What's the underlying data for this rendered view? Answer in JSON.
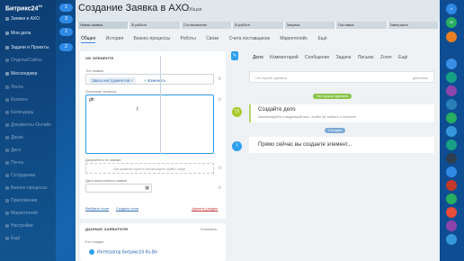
{
  "sidebar": {
    "brand": "Битрикс24",
    "items": [
      {
        "label": "Заявки в АХО"
      },
      {
        "label": "Мои дела"
      },
      {
        "label": "Задачи и Проекты"
      },
      {
        "label": "Отделы/Сайты"
      },
      {
        "label": "Мессенджер"
      },
      {
        "label": "Лента"
      },
      {
        "label": "Коллеги"
      },
      {
        "label": "Календарь"
      },
      {
        "label": "Документы Онлайн"
      },
      {
        "label": "Диски"
      },
      {
        "label": "Диск"
      },
      {
        "label": "Почта"
      },
      {
        "label": "Сотрудники"
      },
      {
        "label": "Бизнес-процессы"
      },
      {
        "label": "Приложения"
      },
      {
        "label": "Маркетплейс"
      },
      {
        "label": "Настройки"
      },
      {
        "label": "Ещё"
      }
    ],
    "bubbles": [
      "1",
      "3",
      "1",
      "2"
    ]
  },
  "header": {
    "title": "Создание Заявка в АХО",
    "subtitle": "Общая",
    "stages": [
      "Новая заявка",
      "В работе",
      "Согласование",
      "В работе",
      "Закупка",
      "Поставка",
      "Завершить"
    ]
  },
  "tabs": [
    "Общее",
    "История",
    "Бизнес-процессы",
    "Роботы",
    "Связи",
    "Счета поставщиков",
    "Маркетплейс",
    "Ещё"
  ],
  "about": {
    "title": "ОБ ЭЛЕМЕНТЕ",
    "type_label": "Тип заявки",
    "type_value": "Заказ инструментов",
    "change_link": "Изменить",
    "desc_label": "Описание запроса",
    "desc_value": "gh",
    "docs_label": "Документы по заявке",
    "dropzone_text": "Вы можете просто перетащить файл сюда",
    "date_label": "Дата выполнения заявки",
    "choose_field": "Выбрать поле",
    "create_field": "Создать поле",
    "delete_section": "Удалить раздел"
  },
  "client": {
    "title": "ДАННЫЕ ЗАЯВИТЕЛЯ",
    "action": "Отменить",
    "label": "Кто создал",
    "name": "Интегратор Битрикс24 Ко-Вя"
  },
  "timeline": {
    "tabs": [
      "Дело",
      "Комментарий",
      "Сообщение",
      "Задача",
      "Письмо",
      "Zoom",
      "Ещё"
    ],
    "input_placeholder": "Что нужно сделать",
    "input_action": "действия",
    "pill_planned": "Что нужно сделать",
    "create_title": "Создайте дело",
    "create_sub": "Запланируйте следующий шаг, чтобы не забыть о клиенте",
    "pill_today": "Сегодня",
    "info_text": "Прямо сейчас вы создаете элемент..."
  },
  "right_rail": [
    "",
    "",
    "",
    "",
    "",
    "",
    "",
    "",
    "",
    "",
    "",
    "",
    "",
    "",
    ""
  ]
}
